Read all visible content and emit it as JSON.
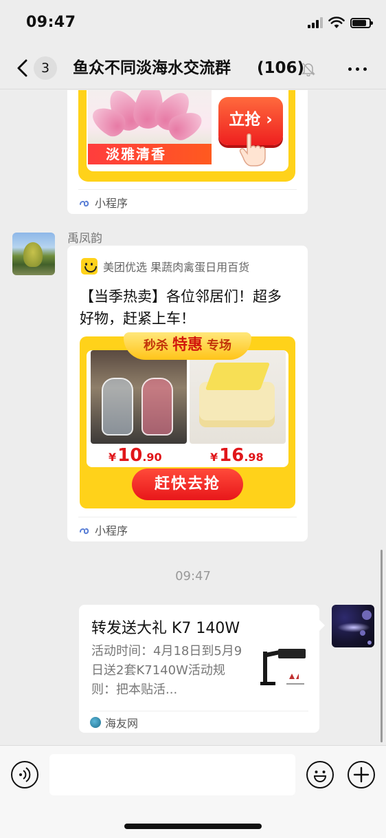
{
  "status_bar": {
    "time": "09:47"
  },
  "nav": {
    "back_badge": "3",
    "title": "鱼众不同淡海水交流群",
    "member_count": "(106)"
  },
  "messages": {
    "promo1": {
      "flower_label": "淡雅清香",
      "buy_button": "立抢",
      "mini_program": "小程序"
    },
    "sender_name": "禹凤韵",
    "promo2": {
      "app_name": "美团优选 果蔬肉禽蛋日用百货",
      "title": "【当季热卖】各位邻居们！超多好物，赶紧上车！",
      "banner_left": "秒杀",
      "banner_mid": "特惠",
      "banner_right": "专场",
      "price1_yen": "¥",
      "price1_int": "10",
      "price1_dec": ".90",
      "price2_yen": "¥",
      "price2_int": "16",
      "price2_dec": ".98",
      "rush_button": "赶快去抢",
      "mini_program": "小程序"
    },
    "timestamp": "09:47",
    "link_card": {
      "title": "转发送大礼 K7 140W",
      "description": "活动时间：4月18日到5月9日送2套K7140W活动规则：把本贴活...",
      "source": "海友网"
    }
  },
  "input": {
    "placeholder": ""
  },
  "colors": {
    "accent_red": "#e8171a",
    "promo_yellow": "#ffd21a",
    "chat_bg": "#ededed"
  }
}
